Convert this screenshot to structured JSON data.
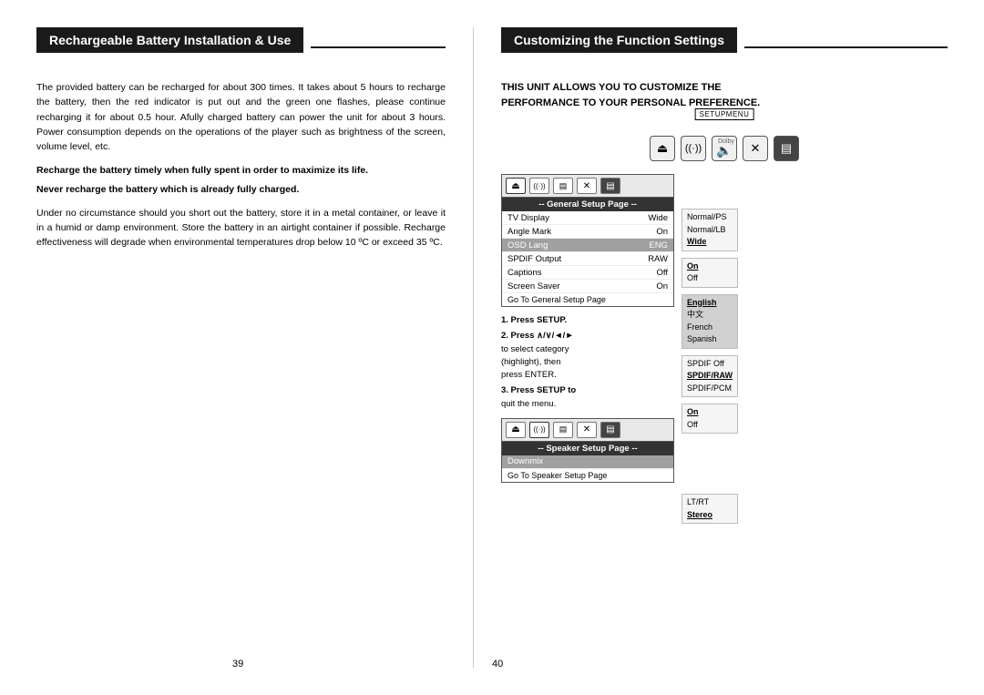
{
  "left": {
    "title": "Rechargeable Battery Installation & Use",
    "para1": "The provided battery can be recharged for about 300 times. It takes about 5 hours to recharge the battery, then the red indicator is put out and the green one flashes, please continue recharging it for about 0.5 hour. Afully charged battery can power the unit for about 3 hours. Power consumption depends on the operations of the player such as brightness of the screen, volume level, etc.",
    "bold1": "Recharge the battery timely when fully spent in order to maximize its life.",
    "bold2": "Never recharge the battery which is already fully charged.",
    "para2": "Under no circumstance should you short out the battery, store it in a metal container, or leave it in a humid or damp environment. Store the battery in an airtight container if possible. Recharge effectiveness will degrade when environmental temperatures drop below 10 ºC or exceed 35 ºC.",
    "page_number": "39"
  },
  "right": {
    "title": "Customizing the Function Settings",
    "intro_line1": "THIS UNIT ALLOWS YOU TO CUSTOMIZE THE",
    "intro_line2": "PERFORMANCE TO YOUR PERSONAL PREFERENCE.",
    "setup_menu_label": "SETUPMENU",
    "remote_icons": [
      "⏏",
      "((·))",
      "Dolby",
      "✕",
      "▤"
    ],
    "general_setup": {
      "header": "-- General Setup Page --",
      "icons": [
        "⏏",
        "((·))",
        "▤",
        "✕",
        "▤"
      ],
      "rows": [
        {
          "label": "TV Display",
          "value": "Wide",
          "highlight": false
        },
        {
          "label": "Angle Mark",
          "value": "On",
          "highlight": false
        },
        {
          "label": "OSD Lang",
          "value": "ENG",
          "highlight": true
        },
        {
          "label": "SPDIF Output",
          "value": "RAW",
          "highlight": false
        },
        {
          "label": "Captions",
          "value": "Off",
          "highlight": false
        },
        {
          "label": "Screen Saver",
          "value": "On",
          "highlight": false
        }
      ],
      "go_to": "Go To General Setup Page"
    },
    "side_groups": [
      {
        "items": [
          "Normal/PS",
          "Normal/LB",
          "Wide"
        ]
      },
      {
        "items": [
          "On",
          "Off"
        ]
      },
      {
        "items": [
          "English",
          "中文",
          "French",
          "Spanish"
        ]
      },
      {
        "items": [
          "SPDIF Off",
          "SPDIF/RAW",
          "SPDIF/PCM"
        ]
      },
      {
        "items": [
          "On",
          "Off"
        ]
      }
    ],
    "instructions": [
      {
        "num": "1",
        "text": "Press SETUP."
      },
      {
        "num": "2",
        "text": "Press ∧/∨/◄/► to select category (highlight), then press ENTER."
      },
      {
        "num": "3",
        "text": "Press SETUP to quit the menu."
      }
    ],
    "speaker_setup": {
      "header": "-- Speaker Setup Page --",
      "icons": [
        "⏏",
        "((·))",
        "▤",
        "✕",
        "▤"
      ],
      "rows": [
        {
          "label": "Downmix",
          "value": "",
          "highlight": true
        }
      ],
      "go_to": "Go To Speaker Setup Page"
    },
    "speaker_side_groups": [
      {
        "items": [
          "LT/RT",
          "Stereo"
        ]
      }
    ],
    "page_number": "40"
  }
}
